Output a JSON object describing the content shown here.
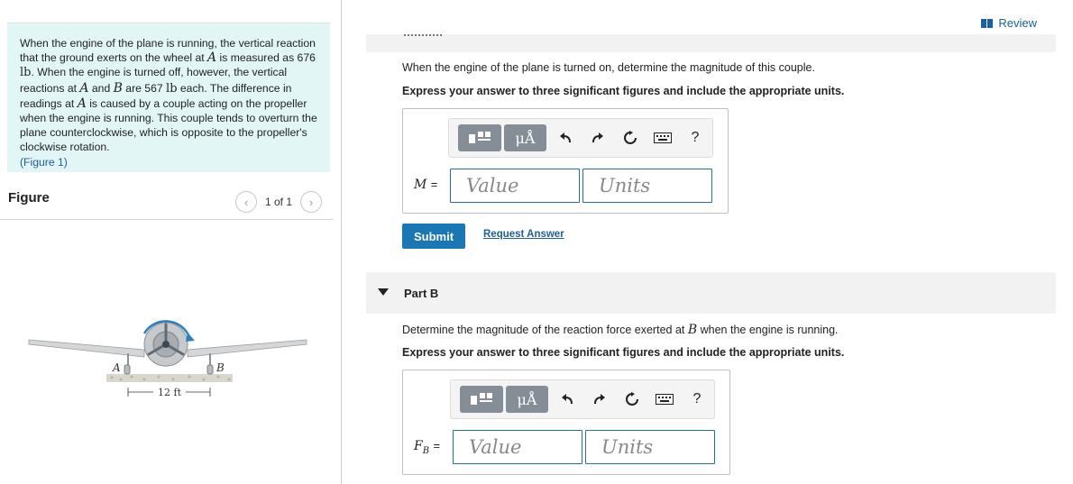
{
  "problem": {
    "t1": "When the engine of the plane is running, the vertical reaction that the ground exerts on the wheel at ",
    "sym_A": "A",
    "t2": " is measured as 676 ",
    "unit_lb": "lb",
    "t3": ". When the engine is turned off, however, the vertical reactions at ",
    "sym_A2": "A",
    "t4": " and ",
    "sym_B": "B",
    "t5": " are 567 ",
    "unit_lb2": "lb",
    "t6": " each. The difference in readings at ",
    "sym_A3": "A",
    "t7": " is caused by a couple acting on the propeller when the engine is running. This couple tends to overturn the plane counterclockwise, which is opposite to the propeller's clockwise rotation.",
    "figure_link": "(Figure 1)"
  },
  "figure": {
    "title": "Figure",
    "pager_text": "1 of 1",
    "prev_icon": "chevron-left-icon",
    "next_icon": "chevron-right-icon",
    "label_A": "A",
    "label_B": "B",
    "dimension": "12 ft"
  },
  "review": {
    "label": "Review",
    "icon": "review-icon"
  },
  "partA": {
    "question": "When the engine of the plane is turned on, determine the magnitude of this couple.",
    "instruction": "Express your answer to three significant figures and include the appropriate units.",
    "var_label": "M",
    "equals": "=",
    "value_placeholder": "Value",
    "units_placeholder": "Units",
    "submit_label": "Submit",
    "request_label": "Request Answer"
  },
  "partB": {
    "title": "Part B",
    "question_pre": "Determine the magnitude of the reaction force exerted at ",
    "question_sym": "B",
    "question_post": " when the engine is running.",
    "instruction": "Express your answer to three significant figures and include the appropriate units.",
    "var_label": "F",
    "var_sub": "B",
    "equals": "=",
    "value_placeholder": "Value",
    "units_placeholder": "Units"
  },
  "toolbar": {
    "mu_label": "μÅ",
    "help_label": "?",
    "icons": [
      "templates-icon",
      "units-icon",
      "undo-icon",
      "redo-icon",
      "reset-icon",
      "keyboard-icon",
      "help-icon"
    ]
  },
  "colors": {
    "problem_bg": "#e1f6f5",
    "link": "#1b5fa8",
    "submit": "#1a77b4",
    "field_border": "#1f6fb5"
  }
}
